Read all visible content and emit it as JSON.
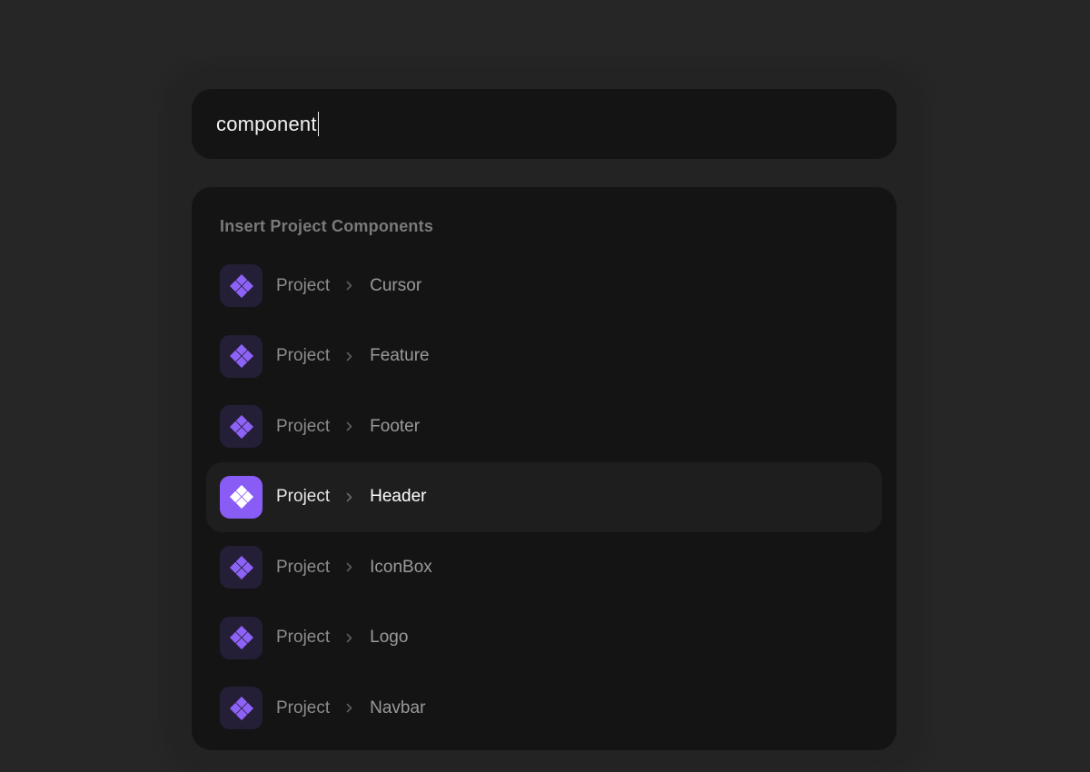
{
  "search": {
    "value": "component"
  },
  "results": {
    "heading": "Insert Project Components",
    "items": [
      {
        "parent": "Project",
        "name": "Cursor",
        "active": false
      },
      {
        "parent": "Project",
        "name": "Feature",
        "active": false
      },
      {
        "parent": "Project",
        "name": "Footer",
        "active": false
      },
      {
        "parent": "Project",
        "name": "Header",
        "active": true
      },
      {
        "parent": "Project",
        "name": "IconBox",
        "active": false
      },
      {
        "parent": "Project",
        "name": "Logo",
        "active": false
      },
      {
        "parent": "Project",
        "name": "Navbar",
        "active": false
      }
    ]
  },
  "icons": {
    "item": "component-icon",
    "separator": "chevron-right-icon"
  },
  "colors": {
    "page_background": "#262626",
    "panel_background": "#141414",
    "active_row_background": "#1e1e1e",
    "accent": "#8a5cf6",
    "icon_tile_background": "#251e37"
  }
}
